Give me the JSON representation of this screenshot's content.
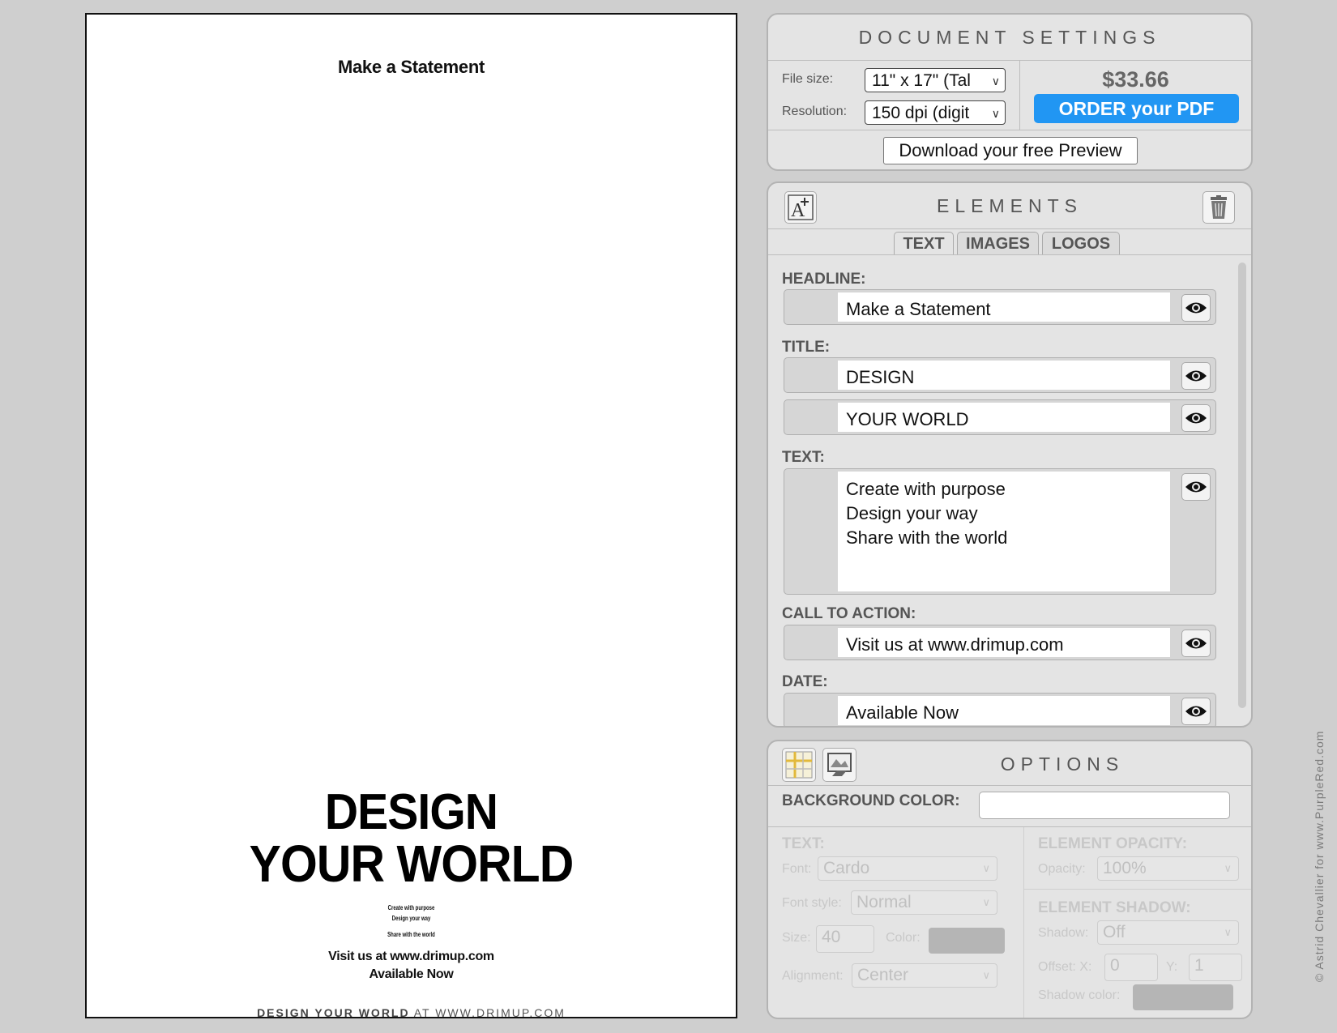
{
  "poster": {
    "headline": "Make a Statement",
    "title_line1": "DESIGN",
    "title_line2": "YOUR WORLD",
    "text_lines": [
      "Create with purpose",
      "Design your way",
      "Share with the world"
    ],
    "cta": "Visit us at www.drimup.com",
    "date": "Available Now",
    "footer_brand": "DESIGN YOUR WORLD",
    "footer_rest": "AT WWW.DRIMUP.COM"
  },
  "document_settings": {
    "title": "DOCUMENT SETTINGS",
    "file_size_label": "File size:",
    "file_size_value": "11\" x 17\" (Tal",
    "resolution_label": "Resolution:",
    "resolution_value": "150 dpi (digit",
    "price": "$33.66",
    "order_button": "ORDER your PDF",
    "preview_button": "Download your free Preview"
  },
  "elements": {
    "title": "ELEMENTS",
    "tabs": [
      "TEXT",
      "IMAGES",
      "LOGOS"
    ],
    "headline_label": "HEADLINE:",
    "headline_value": "Make a Statement",
    "title_label": "TITLE:",
    "title_value_1": "DESIGN",
    "title_value_2": "YOUR WORLD",
    "text_label": "TEXT:",
    "text_value": "Create with purpose\nDesign your way\nShare with the world",
    "cta_label": "CALL TO ACTION:",
    "cta_value": "Visit us at www.drimup.com",
    "date_label": "DATE:",
    "date_value": "Available Now"
  },
  "options": {
    "title": "OPTIONS",
    "background_color_label": "BACKGROUND COLOR:",
    "background_color": "#ffffff",
    "text_heading": "TEXT:",
    "font_label": "Font:",
    "font_value": "Cardo",
    "font_style_label": "Font style:",
    "font_style_value": "Normal",
    "size_label": "Size:",
    "size_value": "40",
    "color_label": "Color:",
    "alignment_label": "Alignment:",
    "alignment_value": "Center",
    "opacity_heading": "ELEMENT OPACITY:",
    "opacity_label": "Opacity:",
    "opacity_value": "100%",
    "shadow_heading": "ELEMENT SHADOW:",
    "shadow_label": "Shadow:",
    "shadow_value": "Off",
    "offset_x_label": "Offset: X:",
    "offset_x_value": "0",
    "offset_y_label": "Y:",
    "offset_y_value": "1",
    "shadow_color_label": "Shadow color:"
  },
  "watermark": "© Astrid Chevallier for www.PurpleRed.com",
  "colors": {
    "accent": "#2196f3",
    "panel_bg": "#e4e4e4",
    "page_bg": "#cfcfcf"
  }
}
